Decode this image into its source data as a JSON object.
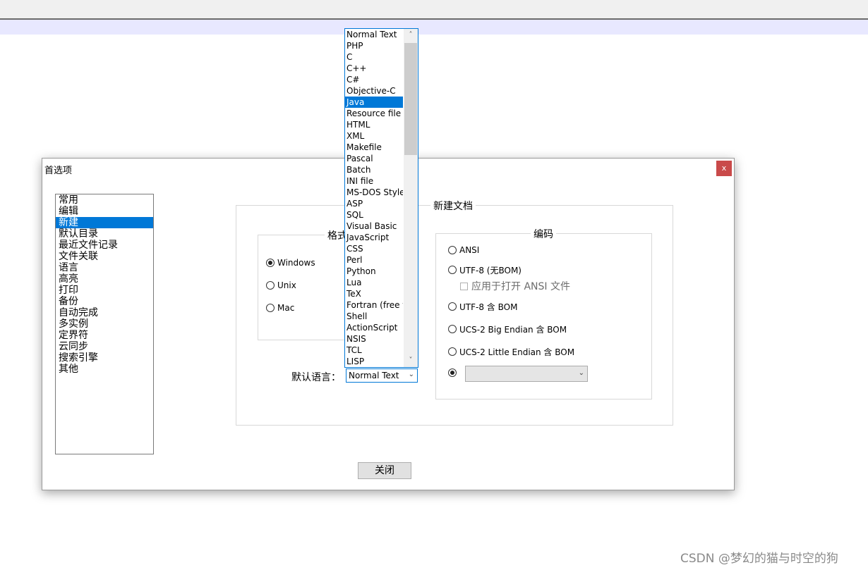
{
  "dialog": {
    "title": "首选项",
    "close_glyph": "x",
    "close_button_label": "关闭"
  },
  "categories": [
    {
      "label": "常用"
    },
    {
      "label": "编辑"
    },
    {
      "label": "新建",
      "selected": true
    },
    {
      "label": "默认目录"
    },
    {
      "label": "最近文件记录"
    },
    {
      "label": "文件关联"
    },
    {
      "label": "语言"
    },
    {
      "label": "高亮"
    },
    {
      "label": "打印"
    },
    {
      "label": "备份"
    },
    {
      "label": "自动完成"
    },
    {
      "label": "多实例"
    },
    {
      "label": "定界符"
    },
    {
      "label": "云同步"
    },
    {
      "label": "搜索引擎"
    },
    {
      "label": "其他"
    }
  ],
  "new_document": {
    "title": "新建文档",
    "format": {
      "title": "格式",
      "options": [
        {
          "label": "Windows",
          "checked": true
        },
        {
          "label": "Unix",
          "checked": false
        },
        {
          "label": "Mac",
          "checked": false
        }
      ]
    },
    "default_language": {
      "label": "默认语言：",
      "value": "Normal Text"
    },
    "encoding": {
      "title": "编码",
      "options": [
        {
          "label": "ANSI",
          "checked": false
        },
        {
          "label": "UTF-8 (无BOM)",
          "checked": false
        },
        {
          "label": "UTF-8 含 BOM",
          "checked": false
        },
        {
          "label": "UCS-2 Big Endian 含 BOM",
          "checked": false
        },
        {
          "label": "UCS-2 Little Endian 含 BOM",
          "checked": false
        }
      ],
      "apply_checkbox": {
        "label": "应用于打开 ANSI 文件",
        "checked": false,
        "enabled": false
      },
      "custom_checked": true
    }
  },
  "language_dropdown": {
    "items": [
      "Normal Text",
      "PHP",
      "C",
      "C++",
      "C#",
      "Objective-C",
      "Java",
      "Resource file",
      "HTML",
      "XML",
      "Makefile",
      "Pascal",
      "Batch",
      "INI file",
      "MS-DOS Style",
      "ASP",
      "SQL",
      "Visual Basic",
      "JavaScript",
      "CSS",
      "Perl",
      "Python",
      "Lua",
      "TeX",
      "Fortran (free fo",
      "Shell",
      "ActionScript",
      "NSIS",
      "TCL",
      "LISP"
    ],
    "selected": "Java"
  },
  "watermark": "CSDN @梦幻的猫与时空的狗"
}
